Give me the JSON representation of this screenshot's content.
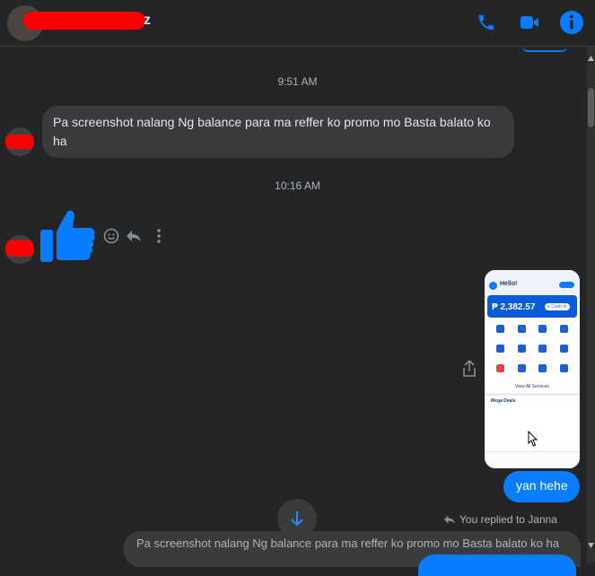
{
  "header": {
    "name_tail": "z",
    "icons": {
      "call": "phone-icon",
      "video": "video-camera-icon",
      "info": "info-icon"
    }
  },
  "messages": {
    "time1": "9:51 AM",
    "msg1": "Pa screenshot nalang Ng balance para ma reffer ko promo mo Basta balato ko ha",
    "time2": "10:16 AM",
    "out_text": "yan hehe",
    "replied_label": "You replied to Janna",
    "quoted_text": "Pa screenshot nalang Ng balance para ma reffer ko promo mo Basta balato ko ha"
  },
  "screenshot": {
    "greeting": "Hello!",
    "balance": "₱ 2,382.57",
    "cash_in": "+ Cash In",
    "view_all": "View All Services",
    "mega_deals": "Mega Deals"
  },
  "colors": {
    "accent": "#0a7cff",
    "background": "#242526",
    "bubble_in": "#3a3b3c",
    "redaction": "#ff0000"
  }
}
